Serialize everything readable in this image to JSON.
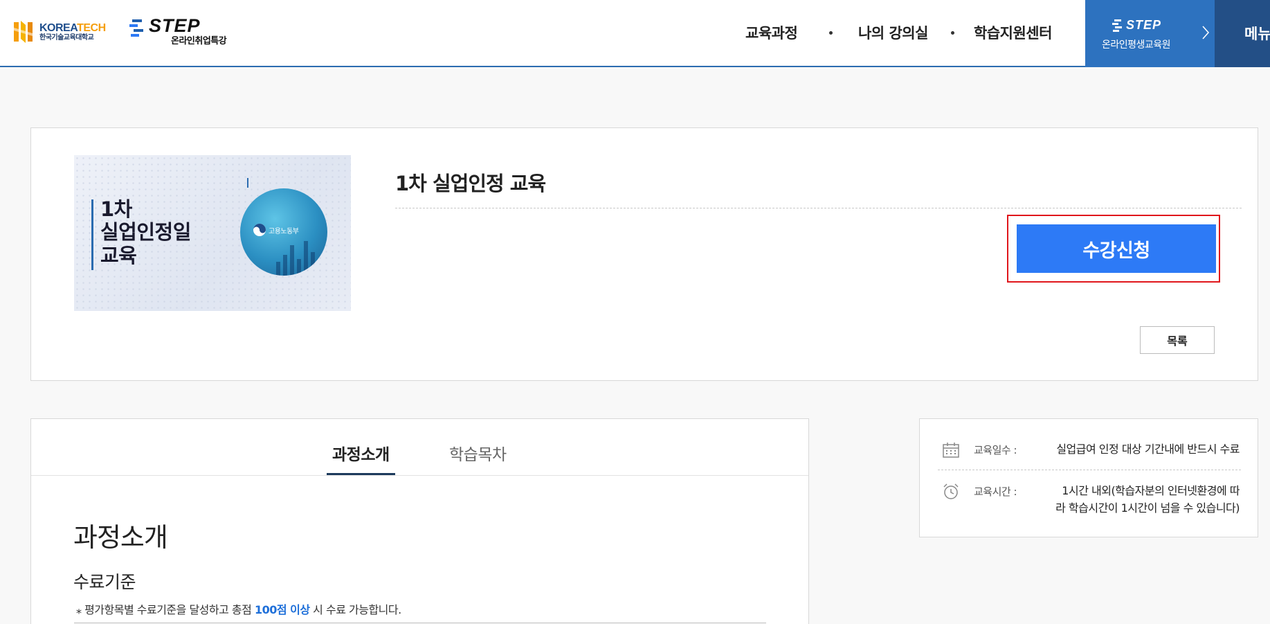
{
  "header": {
    "koreatech_en_1": "KOREA",
    "koreatech_en_2": "TECH",
    "koreatech_ko": "한국기술교육대학교",
    "step_en": "STEP",
    "step_ko": "온라인취업특강",
    "nav": [
      "교육과정",
      "나의 강의실",
      "학습지원센터"
    ],
    "step_edu_en": "STEP",
    "step_edu_ko": "온라인평생교육원",
    "menu_label": "메뉴"
  },
  "course": {
    "thumbnail_title": "1차\n실업인정일\n교육",
    "thumbnail_ministry": "고용노동부",
    "title": "1차 실업인정 교육",
    "apply_label": "수강신청",
    "list_label": "목록"
  },
  "tabs": {
    "items": [
      "과정소개",
      "학습목차"
    ],
    "active": "과정소개"
  },
  "content": {
    "section_title": "과정소개",
    "sub_title": "수료기준",
    "criteria_prefix": "⁎ 평가항목별 수료기준을 달성하고 총점 ",
    "criteria_highlight": "100점 이상",
    "criteria_suffix": " 시 수료 가능합니다."
  },
  "info": {
    "days_label": "교육일수 :",
    "days_value": "실업급여 인정 대상 기간내에 반드시 수료",
    "time_label": "교육시간 :",
    "time_value_1": "1시간 내외(학습자분의 인터넷환경에 따",
    "time_value_2": "라 학습시간이 1시간이 넘을 수 있습니다)"
  },
  "colors": {
    "primary_blue": "#2d7af6",
    "header_blue": "#2d72bf",
    "menu_navy": "#234f86",
    "highlight_red": "#e0161b",
    "link_blue": "#1e6fd9"
  }
}
